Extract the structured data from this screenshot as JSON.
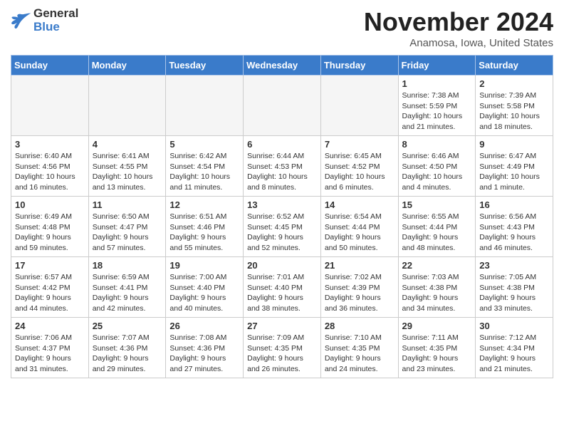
{
  "logo": {
    "general": "General",
    "blue": "Blue"
  },
  "title": "November 2024",
  "location": "Anamosa, Iowa, United States",
  "weekdays": [
    "Sunday",
    "Monday",
    "Tuesday",
    "Wednesday",
    "Thursday",
    "Friday",
    "Saturday"
  ],
  "weeks": [
    [
      {
        "day": "",
        "info": ""
      },
      {
        "day": "",
        "info": ""
      },
      {
        "day": "",
        "info": ""
      },
      {
        "day": "",
        "info": ""
      },
      {
        "day": "",
        "info": ""
      },
      {
        "day": "1",
        "info": "Sunrise: 7:38 AM\nSunset: 5:59 PM\nDaylight: 10 hours and 21 minutes."
      },
      {
        "day": "2",
        "info": "Sunrise: 7:39 AM\nSunset: 5:58 PM\nDaylight: 10 hours and 18 minutes."
      }
    ],
    [
      {
        "day": "3",
        "info": "Sunrise: 6:40 AM\nSunset: 4:56 PM\nDaylight: 10 hours and 16 minutes."
      },
      {
        "day": "4",
        "info": "Sunrise: 6:41 AM\nSunset: 4:55 PM\nDaylight: 10 hours and 13 minutes."
      },
      {
        "day": "5",
        "info": "Sunrise: 6:42 AM\nSunset: 4:54 PM\nDaylight: 10 hours and 11 minutes."
      },
      {
        "day": "6",
        "info": "Sunrise: 6:44 AM\nSunset: 4:53 PM\nDaylight: 10 hours and 8 minutes."
      },
      {
        "day": "7",
        "info": "Sunrise: 6:45 AM\nSunset: 4:52 PM\nDaylight: 10 hours and 6 minutes."
      },
      {
        "day": "8",
        "info": "Sunrise: 6:46 AM\nSunset: 4:50 PM\nDaylight: 10 hours and 4 minutes."
      },
      {
        "day": "9",
        "info": "Sunrise: 6:47 AM\nSunset: 4:49 PM\nDaylight: 10 hours and 1 minute."
      }
    ],
    [
      {
        "day": "10",
        "info": "Sunrise: 6:49 AM\nSunset: 4:48 PM\nDaylight: 9 hours and 59 minutes."
      },
      {
        "day": "11",
        "info": "Sunrise: 6:50 AM\nSunset: 4:47 PM\nDaylight: 9 hours and 57 minutes."
      },
      {
        "day": "12",
        "info": "Sunrise: 6:51 AM\nSunset: 4:46 PM\nDaylight: 9 hours and 55 minutes."
      },
      {
        "day": "13",
        "info": "Sunrise: 6:52 AM\nSunset: 4:45 PM\nDaylight: 9 hours and 52 minutes."
      },
      {
        "day": "14",
        "info": "Sunrise: 6:54 AM\nSunset: 4:44 PM\nDaylight: 9 hours and 50 minutes."
      },
      {
        "day": "15",
        "info": "Sunrise: 6:55 AM\nSunset: 4:44 PM\nDaylight: 9 hours and 48 minutes."
      },
      {
        "day": "16",
        "info": "Sunrise: 6:56 AM\nSunset: 4:43 PM\nDaylight: 9 hours and 46 minutes."
      }
    ],
    [
      {
        "day": "17",
        "info": "Sunrise: 6:57 AM\nSunset: 4:42 PM\nDaylight: 9 hours and 44 minutes."
      },
      {
        "day": "18",
        "info": "Sunrise: 6:59 AM\nSunset: 4:41 PM\nDaylight: 9 hours and 42 minutes."
      },
      {
        "day": "19",
        "info": "Sunrise: 7:00 AM\nSunset: 4:40 PM\nDaylight: 9 hours and 40 minutes."
      },
      {
        "day": "20",
        "info": "Sunrise: 7:01 AM\nSunset: 4:40 PM\nDaylight: 9 hours and 38 minutes."
      },
      {
        "day": "21",
        "info": "Sunrise: 7:02 AM\nSunset: 4:39 PM\nDaylight: 9 hours and 36 minutes."
      },
      {
        "day": "22",
        "info": "Sunrise: 7:03 AM\nSunset: 4:38 PM\nDaylight: 9 hours and 34 minutes."
      },
      {
        "day": "23",
        "info": "Sunrise: 7:05 AM\nSunset: 4:38 PM\nDaylight: 9 hours and 33 minutes."
      }
    ],
    [
      {
        "day": "24",
        "info": "Sunrise: 7:06 AM\nSunset: 4:37 PM\nDaylight: 9 hours and 31 minutes."
      },
      {
        "day": "25",
        "info": "Sunrise: 7:07 AM\nSunset: 4:36 PM\nDaylight: 9 hours and 29 minutes."
      },
      {
        "day": "26",
        "info": "Sunrise: 7:08 AM\nSunset: 4:36 PM\nDaylight: 9 hours and 27 minutes."
      },
      {
        "day": "27",
        "info": "Sunrise: 7:09 AM\nSunset: 4:35 PM\nDaylight: 9 hours and 26 minutes."
      },
      {
        "day": "28",
        "info": "Sunrise: 7:10 AM\nSunset: 4:35 PM\nDaylight: 9 hours and 24 minutes."
      },
      {
        "day": "29",
        "info": "Sunrise: 7:11 AM\nSunset: 4:35 PM\nDaylight: 9 hours and 23 minutes."
      },
      {
        "day": "30",
        "info": "Sunrise: 7:12 AM\nSunset: 4:34 PM\nDaylight: 9 hours and 21 minutes."
      }
    ]
  ]
}
